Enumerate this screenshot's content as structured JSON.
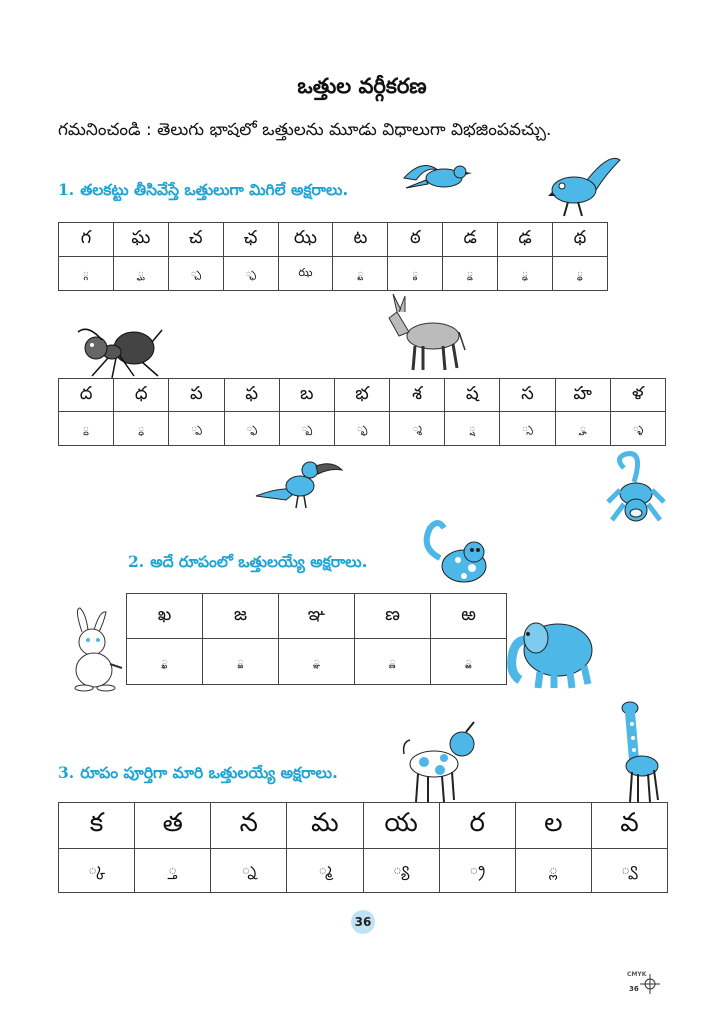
{
  "page_title": "ఒత్తుల వర్గీకరణ",
  "intro": "గమనించండి : తెలుగు భాషలో ఒత్తులను మూడు విధాలుగా విభజింపవచ్చు.",
  "section1": {
    "number": "1.",
    "title": "తలకట్టు తీసివేస్తే ఒత్తులుగా మిగిలే అక్షరాలు.",
    "table_a": {
      "letters": [
        "గ",
        "ఘ",
        "చ",
        "ఛ",
        "ఝ",
        "ట",
        "ఠ",
        "డ",
        "ఢ",
        "థ"
      ],
      "ottulu": [
        "్గ",
        "్ఘ",
        "్చ",
        "్ఛ",
        "ఝ",
        "్ట",
        "్ఠ",
        "్డ",
        "్ఢ",
        "్థ"
      ]
    },
    "table_b": {
      "letters": [
        "ద",
        "ధ",
        "ప",
        "ఫ",
        "బ",
        "భ",
        "శ",
        "ష",
        "స",
        "హ",
        "ళ"
      ],
      "ottulu": [
        "్ద",
        "్ధ",
        "్ప",
        "్ఫ",
        "్బ",
        "్భ",
        "్శ",
        "్ష",
        "్స",
        "్హ",
        "్ళ"
      ]
    }
  },
  "section2": {
    "number": "2.",
    "title": "అదే రూపంలో ఒత్తులయ్యే అక్షరాలు.",
    "table": {
      "letters": [
        "ఖ",
        "జ",
        "ఞ",
        "ణ",
        "ఱ"
      ],
      "ottulu": [
        "్ఖ",
        "్జ",
        "్ఞ",
        "్ణ",
        "్ఱ"
      ]
    }
  },
  "section3": {
    "number": "3.",
    "title": "రూపం పూర్తిగా మారి ఒత్తులయ్యే అక్షరాలు.",
    "table": {
      "letters": [
        "క",
        "త",
        "న",
        "మ",
        "య",
        "ర",
        "ల",
        "వ"
      ],
      "ottulu": [
        "్క",
        "్త",
        "్న",
        "్మ",
        "్య",
        "్ర",
        "్ల",
        "్వ"
      ]
    }
  },
  "page_number": "36",
  "print_marks": {
    "cmyk": "CMYK",
    "page": "36"
  },
  "colors": {
    "accent": "#1ea4d4",
    "animal_blue": "#4db8e8",
    "ink": "#111111"
  },
  "illustrations": [
    "bird-icon",
    "bird-icon",
    "ant-icon",
    "donkey-icon",
    "hornbill-icon",
    "monkey-icon",
    "cat-icon",
    "rabbit-icon",
    "elephant-icon",
    "dog-icon",
    "giraffe-icon"
  ]
}
